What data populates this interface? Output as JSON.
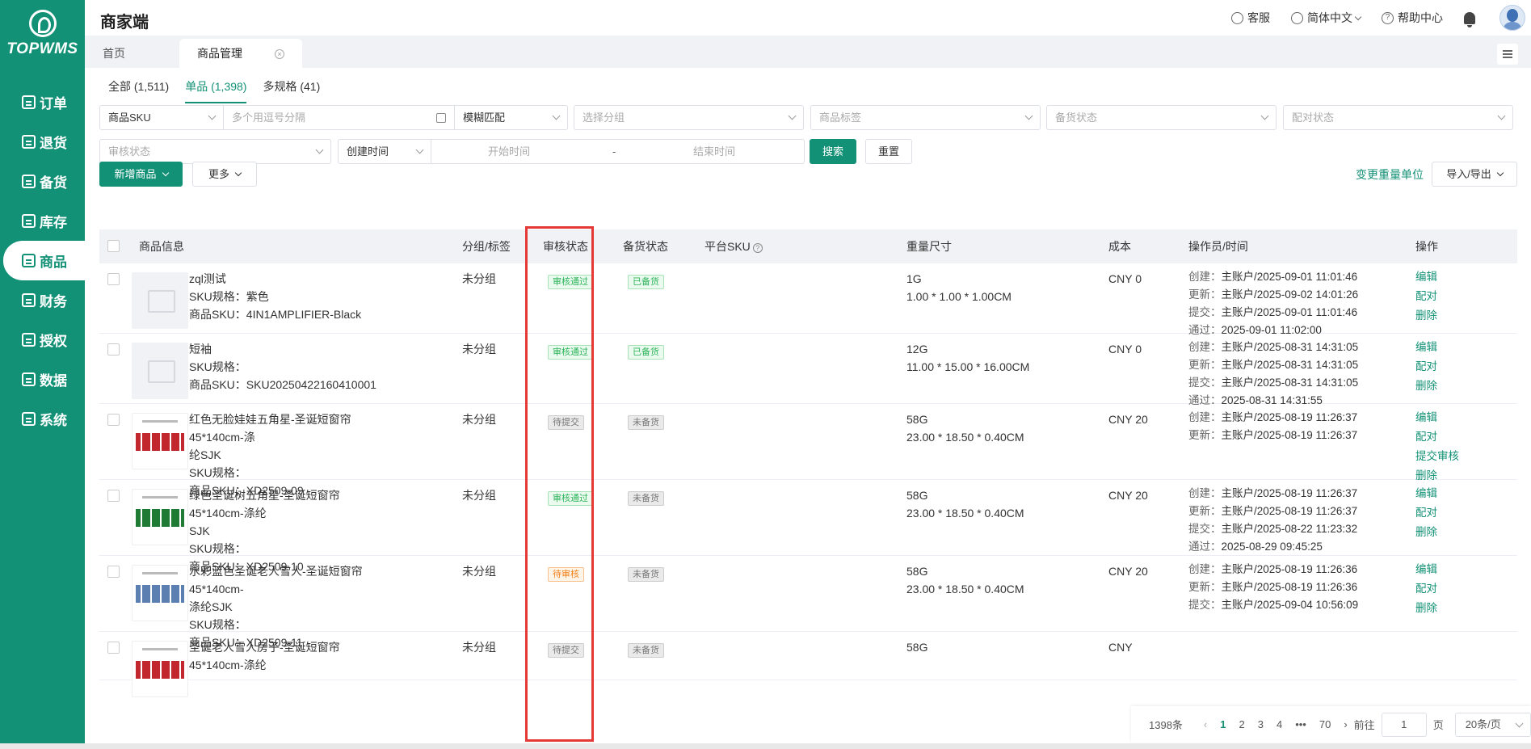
{
  "brand": {
    "logo_text": "TOPWMS",
    "accent": "#139176"
  },
  "nav": {
    "items": [
      {
        "label": "订单",
        "icon": "order-icon"
      },
      {
        "label": "退货",
        "icon": "return-icon"
      },
      {
        "label": "备货",
        "icon": "stock-icon"
      },
      {
        "label": "库存",
        "icon": "inventory-icon"
      },
      {
        "label": "商品",
        "icon": "goods-icon",
        "active": true
      },
      {
        "label": "财务",
        "icon": "finance-icon"
      },
      {
        "label": "授权",
        "icon": "auth-icon"
      },
      {
        "label": "数据",
        "icon": "data-icon"
      },
      {
        "label": "系统",
        "icon": "system-icon"
      }
    ]
  },
  "header": {
    "title": "商家端",
    "service": "客服",
    "language": "简体中文",
    "help": "帮助中心"
  },
  "page_tabs": [
    {
      "label": "首页"
    },
    {
      "label": "商品管理",
      "active": true
    }
  ],
  "sub_tabs": [
    "全部 (1,511)",
    "单品 (1,398)",
    "多规格 (41)"
  ],
  "filters": {
    "sku_type": "商品SKU",
    "sku_placeholder": "多个用逗号分隔",
    "match": "模糊匹配",
    "group": "选择分组",
    "tag": "商品标签",
    "stock_status": "备货状态",
    "pair_status": "配对状态",
    "review_status": "审核状态",
    "time_type": "创建时间",
    "start": "开始时间",
    "sep": "-",
    "end": "结束时间",
    "search": "搜索",
    "reset": "重置"
  },
  "actions": {
    "add": "新增商品",
    "more": "更多",
    "change_unit": "变更重量单位",
    "import_export": "导入/导出"
  },
  "table": {
    "headers": {
      "info": "商品信息",
      "group": "分组/标签",
      "review": "审核状态",
      "stock": "备货状态",
      "platform_sku": "平台SKU",
      "weight": "重量尺寸",
      "cost": "成本",
      "operator": "操作员/时间",
      "ops": "操作"
    },
    "rows": [
      {
        "name": "zql测试",
        "name2": "",
        "spec": "SKU规格：紫色",
        "sku": "商品SKU：4IN1AMPLIFIER-Black",
        "group": "未分组",
        "review": "审核通过",
        "review_type": "pass",
        "stock": "已备货",
        "stock_type": "stock",
        "weight": "1G",
        "dims": "1.00 * 1.00 * 1.00CM",
        "cost": "CNY 0",
        "thumb": "placeholder",
        "hist": [
          {
            "k": "创建：",
            "v": "主账户/2025-09-01 11:01:46"
          },
          {
            "k": "更新：",
            "v": "主账户/2025-09-02 14:01:26"
          },
          {
            "k": "提交：",
            "v": "主账户/2025-09-01 11:01:46"
          },
          {
            "k": "通过：",
            "v": "2025-09-01 11:02:00"
          }
        ],
        "ops": [
          "编辑",
          "配对",
          "删除"
        ]
      },
      {
        "name": "短袖",
        "name2": "",
        "spec": "SKU规格：",
        "sku": "商品SKU：SKU20250422160410001",
        "group": "未分组",
        "review": "审核通过",
        "review_type": "pass",
        "stock": "已备货",
        "stock_type": "stock",
        "weight": "12G",
        "dims": "11.00 * 15.00 * 16.00CM",
        "cost": "CNY 0",
        "thumb": "placeholder",
        "hist": [
          {
            "k": "创建：",
            "v": "主账户/2025-08-31 14:31:05"
          },
          {
            "k": "更新：",
            "v": "主账户/2025-08-31 14:31:05"
          },
          {
            "k": "提交：",
            "v": "主账户/2025-08-31 14:31:05"
          },
          {
            "k": "通过：",
            "v": "2025-08-31 14:31:55"
          }
        ],
        "ops": [
          "编辑",
          "配对",
          "删除"
        ]
      },
      {
        "name": "红色无脸娃娃五角星-圣诞短窗帘45*140cm-涤",
        "name2": "纶SJK",
        "spec": "SKU规格：",
        "sku": "商品SKU：XD2509-09",
        "group": "未分组",
        "review": "待提交",
        "review_type": "wait",
        "stock": "未备货",
        "stock_type": "nostock",
        "weight": "58G",
        "dims": "23.00 * 18.50 * 0.40CM",
        "cost": "CNY 20",
        "thumb": "red",
        "hist": [
          {
            "k": "创建：",
            "v": "主账户/2025-08-19 11:26:37"
          },
          {
            "k": "更新：",
            "v": "主账户/2025-08-19 11:26:37"
          }
        ],
        "ops": [
          "编辑",
          "配对",
          "提交审核",
          "删除"
        ]
      },
      {
        "name": "绿色圣诞树五角星-圣诞短窗帘45*140cm-涤纶",
        "name2": "SJK",
        "spec": "SKU规格：",
        "sku": "商品SKU：XD2509-10",
        "group": "未分组",
        "review": "审核通过",
        "review_type": "pass",
        "stock": "未备货",
        "stock_type": "nostock",
        "weight": "58G",
        "dims": "23.00 * 18.50 * 0.40CM",
        "cost": "CNY 20",
        "thumb": "green",
        "hist": [
          {
            "k": "创建：",
            "v": "主账户/2025-08-19 11:26:37"
          },
          {
            "k": "更新：",
            "v": "主账户/2025-08-19 11:26:37"
          },
          {
            "k": "提交：",
            "v": "主账户/2025-08-22 11:23:32"
          },
          {
            "k": "通过：",
            "v": "2025-08-29 09:45:25"
          }
        ],
        "ops": [
          "编辑",
          "配对",
          "删除"
        ]
      },
      {
        "name": "水彩蓝色圣诞老人雪人-圣诞短窗帘45*140cm-",
        "name2": "涤纶SJK",
        "spec": "SKU规格：",
        "sku": "商品SKU：XD2509-11",
        "group": "未分组",
        "review": "待审核",
        "review_type": "review",
        "stock": "未备货",
        "stock_type": "nostock",
        "weight": "58G",
        "dims": "23.00 * 18.50 * 0.40CM",
        "cost": "CNY 20",
        "thumb": "blue",
        "hist": [
          {
            "k": "创建：",
            "v": "主账户/2025-08-19 11:26:36"
          },
          {
            "k": "更新：",
            "v": "主账户/2025-08-19 11:26:36"
          },
          {
            "k": "提交：",
            "v": "主账户/2025-09-04 10:56:09"
          }
        ],
        "ops": [
          "编辑",
          "配对",
          "删除"
        ]
      },
      {
        "name": "圣诞老人雪人房子-圣诞短窗帘45*140cm-涤纶",
        "name2": "",
        "spec": "",
        "sku": "",
        "group": "未分组",
        "review": "待提交",
        "review_type": "wait",
        "stock": "未备货",
        "stock_type": "nostock",
        "weight": "58G",
        "dims": "",
        "cost": "CNY",
        "thumb": "red",
        "hist": [],
        "ops": []
      }
    ]
  },
  "pagination": {
    "total": "1398条",
    "pages": [
      "1",
      "2",
      "3",
      "4",
      "•••",
      "70"
    ],
    "goto": "前往",
    "current": "1",
    "page_unit": "页",
    "page_size": "20条/页"
  }
}
